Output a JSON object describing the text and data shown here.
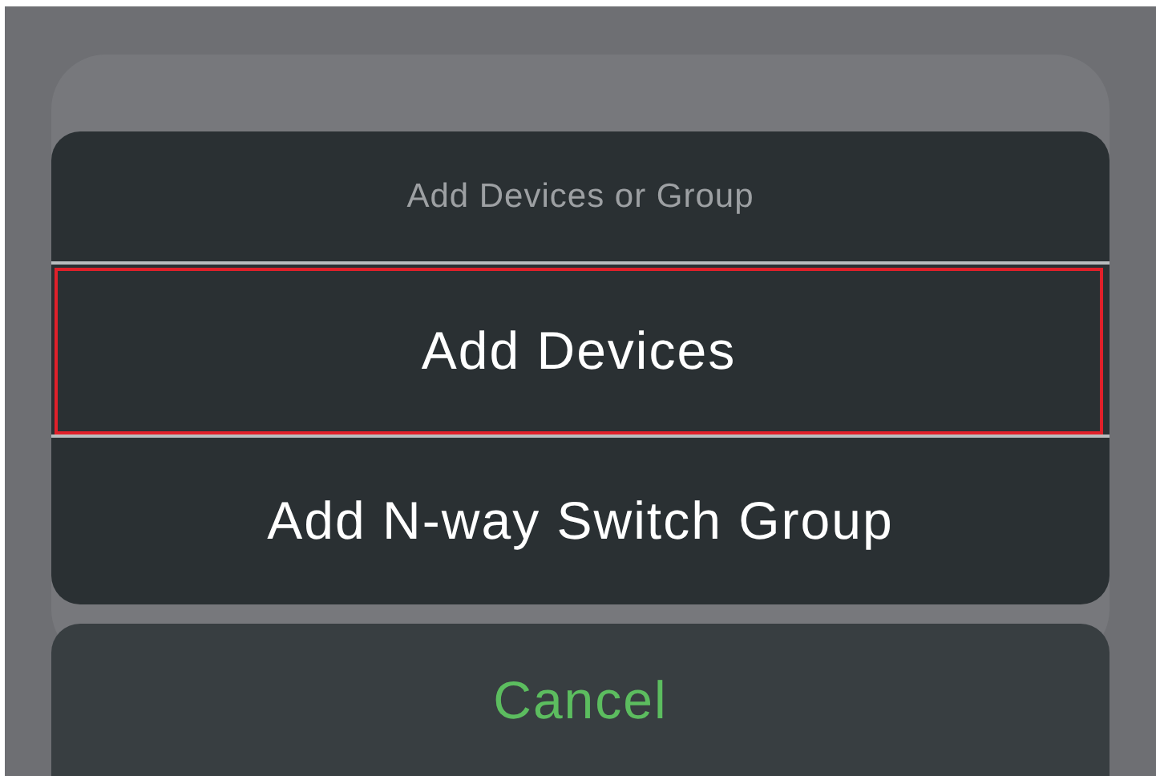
{
  "action_sheet": {
    "title": "Add Devices or Group",
    "options": [
      {
        "label": "Add Devices",
        "highlighted": true
      },
      {
        "label": "Add N-way Switch Group",
        "highlighted": false
      }
    ]
  },
  "cancel_button": {
    "label": "Cancel"
  }
}
